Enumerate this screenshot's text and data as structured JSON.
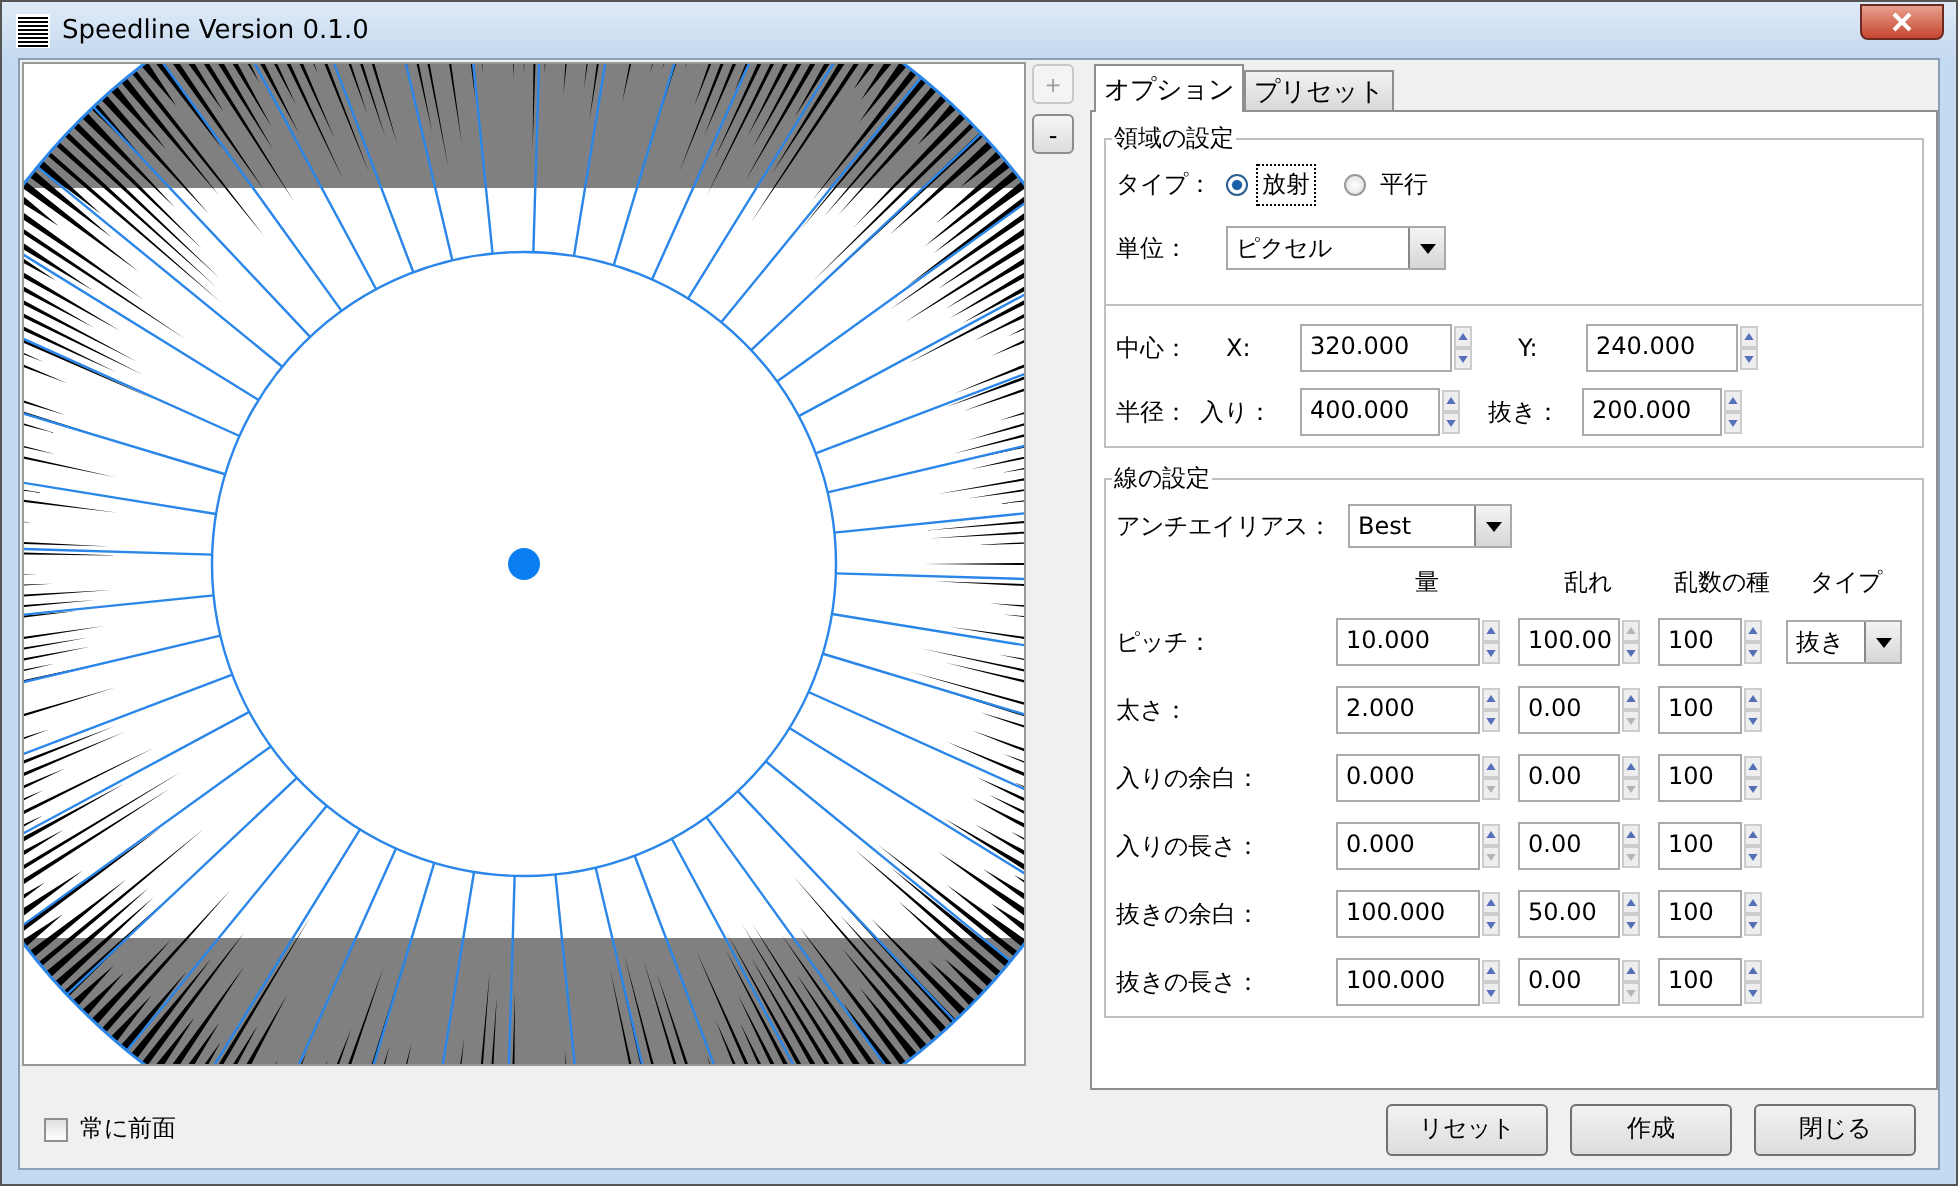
{
  "window": {
    "title": "Speedline Version 0.1.0"
  },
  "zoom_buttons": [
    {
      "label": "+",
      "disabled": true
    },
    {
      "label": "-",
      "disabled": false
    }
  ],
  "tabs": [
    {
      "label": "オプション",
      "selected": true
    },
    {
      "label": "プリセット",
      "selected": false
    }
  ],
  "area_settings": {
    "title": "領域の設定",
    "type_label": "タイプ：",
    "type_options": [
      {
        "label": "放射",
        "selected": true
      },
      {
        "label": "平行",
        "selected": false
      }
    ],
    "unit_label": "単位：",
    "unit_value": "ピクセル",
    "center_label": "中心：",
    "x_label": "X:",
    "x_value": "320.000",
    "y_label": "Y:",
    "y_value": "240.000",
    "radius_label": "半径：",
    "in_label": "入り：",
    "in_value": "400.000",
    "out_label": "抜き：",
    "out_value": "200.000"
  },
  "line_settings": {
    "title": "線の設定",
    "antialias_label": "アンチエイリアス：",
    "antialias_value": "Best",
    "columns": [
      "量",
      "乱れ",
      "乱数の種",
      "タイプ"
    ],
    "rows": [
      {
        "label": "ピッチ：",
        "cells": [
          {
            "value": "10.000",
            "up_disabled": false,
            "down_disabled": false
          },
          {
            "value": "100.00",
            "up_disabled": true,
            "down_disabled": false
          },
          {
            "value": "100",
            "up_disabled": false,
            "down_disabled": false
          }
        ],
        "type_value": "抜き"
      },
      {
        "label": "太さ：",
        "cells": [
          {
            "value": "2.000",
            "up_disabled": false,
            "down_disabled": false
          },
          {
            "value": "0.00",
            "up_disabled": false,
            "down_disabled": true
          },
          {
            "value": "100",
            "up_disabled": false,
            "down_disabled": false
          }
        ]
      },
      {
        "label": "入りの余白：",
        "cells": [
          {
            "value": "0.000",
            "up_disabled": false,
            "down_disabled": true
          },
          {
            "value": "0.00",
            "up_disabled": false,
            "down_disabled": true
          },
          {
            "value": "100",
            "up_disabled": false,
            "down_disabled": false
          }
        ]
      },
      {
        "label": "入りの長さ：",
        "cells": [
          {
            "value": "0.000",
            "up_disabled": false,
            "down_disabled": true
          },
          {
            "value": "0.00",
            "up_disabled": false,
            "down_disabled": true
          },
          {
            "value": "100",
            "up_disabled": false,
            "down_disabled": false
          }
        ]
      },
      {
        "label": "抜きの余白：",
        "cells": [
          {
            "value": "100.000",
            "up_disabled": false,
            "down_disabled": false
          },
          {
            "value": "50.00",
            "up_disabled": false,
            "down_disabled": false
          },
          {
            "value": "100",
            "up_disabled": false,
            "down_disabled": false
          }
        ]
      },
      {
        "label": "抜きの長さ：",
        "cells": [
          {
            "value": "100.000",
            "up_disabled": false,
            "down_disabled": false
          },
          {
            "value": "0.00",
            "up_disabled": false,
            "down_disabled": true
          },
          {
            "value": "100",
            "up_disabled": false,
            "down_disabled": false
          }
        ]
      }
    ]
  },
  "always_on_top": {
    "label": "常に前面",
    "checked": false
  },
  "buttons": [
    "リセット",
    "作成",
    "閉じる"
  ]
}
